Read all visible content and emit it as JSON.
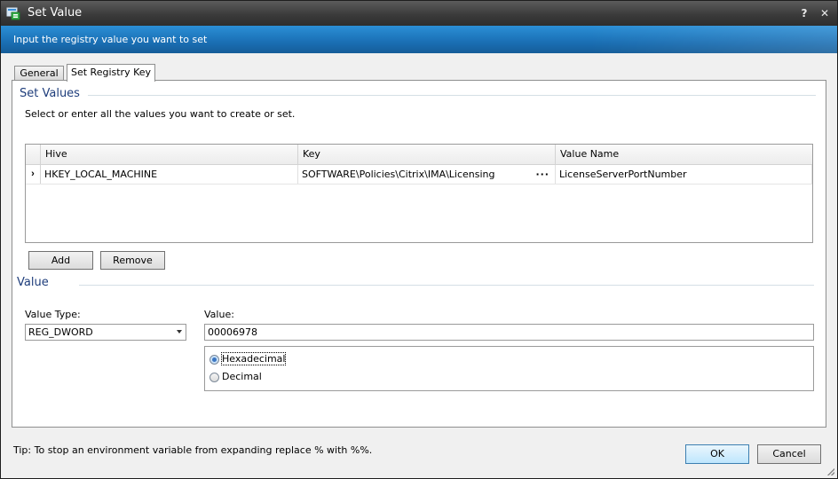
{
  "window": {
    "title": "Set Value",
    "help_glyph": "?",
    "close_glyph": "✕"
  },
  "banner": {
    "text": "Input the registry value you want to set"
  },
  "tabs": [
    {
      "label": "General",
      "active": false
    },
    {
      "label": "Set Registry Key",
      "active": true
    }
  ],
  "set_values": {
    "title": "Set Values",
    "instruction": "Select or enter all the values you want to create or set.",
    "columns": [
      "Hive",
      "Key",
      "Value Name"
    ],
    "rows": [
      {
        "hive": "HKEY_LOCAL_MACHINE",
        "key": "SOFTWARE\\Policies\\Citrix\\IMA\\Licensing",
        "value_name": "LicenseServerPortNumber"
      }
    ],
    "row_selector_glyph": "›",
    "ellipsis": "···",
    "add_label": "Add",
    "remove_label": "Remove"
  },
  "value": {
    "title": "Value",
    "type_label": "Value Type:",
    "type_selected": "REG_DWORD",
    "value_label": "Value:",
    "value_text": "00006978",
    "radio_hex": "Hexadecimal",
    "radio_dec": "Decimal",
    "selected_radio": "Hexadecimal"
  },
  "footer": {
    "tip": "Tip: To stop an environment variable from expanding replace % with %%.",
    "ok_label": "OK",
    "cancel_label": "Cancel"
  }
}
